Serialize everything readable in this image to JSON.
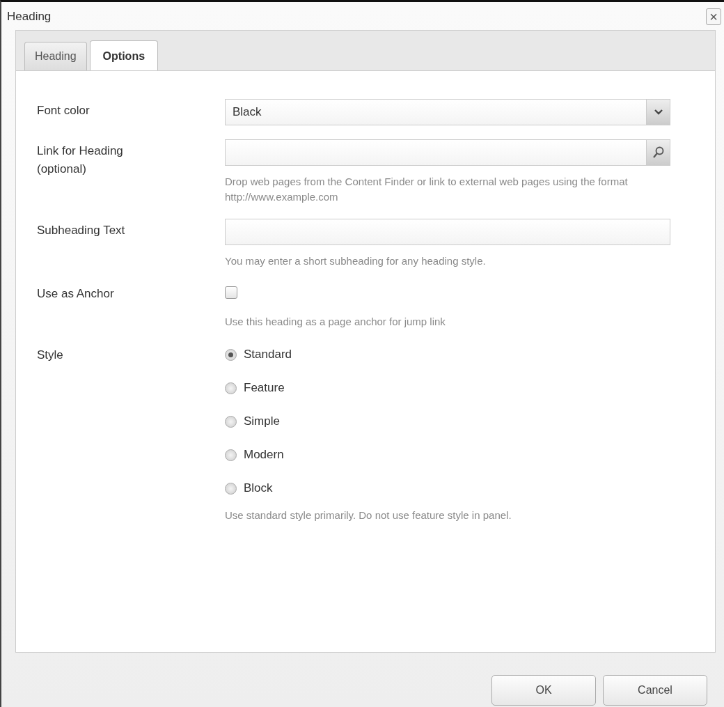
{
  "window": {
    "title": "Heading",
    "close": "×"
  },
  "tabs": [
    {
      "label": "Heading",
      "selected": false
    },
    {
      "label": "Options",
      "selected": true
    }
  ],
  "fields": [
    {
      "kind": "select",
      "label": "Font color",
      "value": "Black"
    },
    {
      "kind": "search",
      "label": "Link for Heading (optional)",
      "help": "Drop web pages from the Content Finder or link to external web pages using the format http://www.example.com"
    },
    {
      "kind": "text",
      "label": "Subheading Text",
      "help": "You may enter a short subheading for any heading style."
    },
    {
      "kind": "checkbox",
      "label": "Use as Anchor",
      "checked": false,
      "help": "Use this heading as a page anchor for jump link"
    },
    {
      "kind": "radio",
      "label": "Style",
      "options": [
        {
          "label": "Standard",
          "selected": true
        },
        {
          "label": "Feature",
          "selected": false
        },
        {
          "label": "Simple",
          "selected": false
        },
        {
          "label": "Modern",
          "selected": false
        },
        {
          "label": "Block",
          "selected": false
        }
      ],
      "help": "Use standard style primarily. Do not use feature style in panel."
    }
  ],
  "buttons": [
    "OK",
    "Cancel"
  ]
}
